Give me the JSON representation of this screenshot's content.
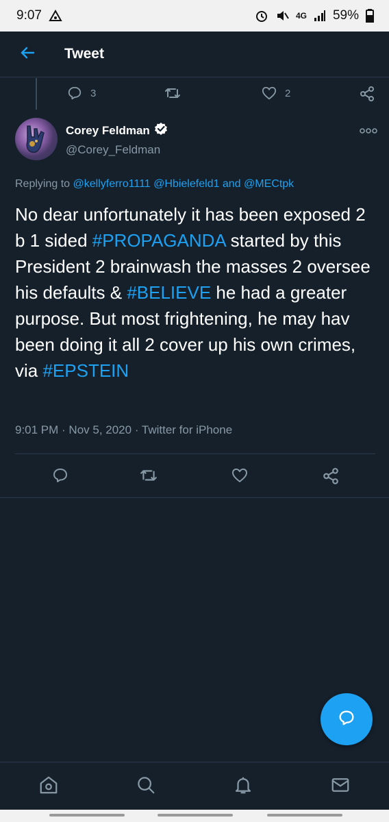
{
  "status_bar": {
    "time": "9:07",
    "network": "4G",
    "battery": "59%"
  },
  "app_bar": {
    "title": "Tweet"
  },
  "previous_tweet_actions": {
    "reply_count": "3",
    "like_count": "2"
  },
  "tweet": {
    "display_name": "Corey Feldman",
    "handle": "@Corey_Feldman",
    "replying_prefix": "Replying to ",
    "mentions": [
      "@kellyferro1111",
      "@Hbielefeld1",
      "@MECtpk"
    ],
    "mention_and": " and ",
    "text_segments": [
      {
        "text": "No dear unfortunately it has been exposed 2 b 1 sided ",
        "type": "plain"
      },
      {
        "text": "#PROPAGANDA",
        "type": "hashtag"
      },
      {
        "text": " started by this President 2 brainwash the masses 2 oversee his defaults & ",
        "type": "plain"
      },
      {
        "text": "#BELIEVE",
        "type": "hashtag"
      },
      {
        "text": " he had a greater purpose. But most frightening, he may hav been doing it all 2 cover up his own crimes, via ",
        "type": "plain"
      },
      {
        "text": "#EPSTEIN",
        "type": "hashtag"
      }
    ],
    "meta": "9:01 PM · Nov 5, 2020 · Twitter for iPhone"
  },
  "colors": {
    "background": "#15202b",
    "accent": "#1da1f2",
    "secondary_text": "#8899a6",
    "divider": "#2b3a4a"
  },
  "icons": {
    "back": "arrow-left-icon",
    "reply": "comment-icon",
    "retweet": "retweet-icon",
    "like": "heart-icon",
    "share": "share-icon",
    "verified": "verified-badge-icon",
    "more": "more-options-icon",
    "compose": "compose-reply-icon",
    "nav": [
      "home-icon",
      "search-icon",
      "notifications-icon",
      "messages-icon"
    ]
  }
}
